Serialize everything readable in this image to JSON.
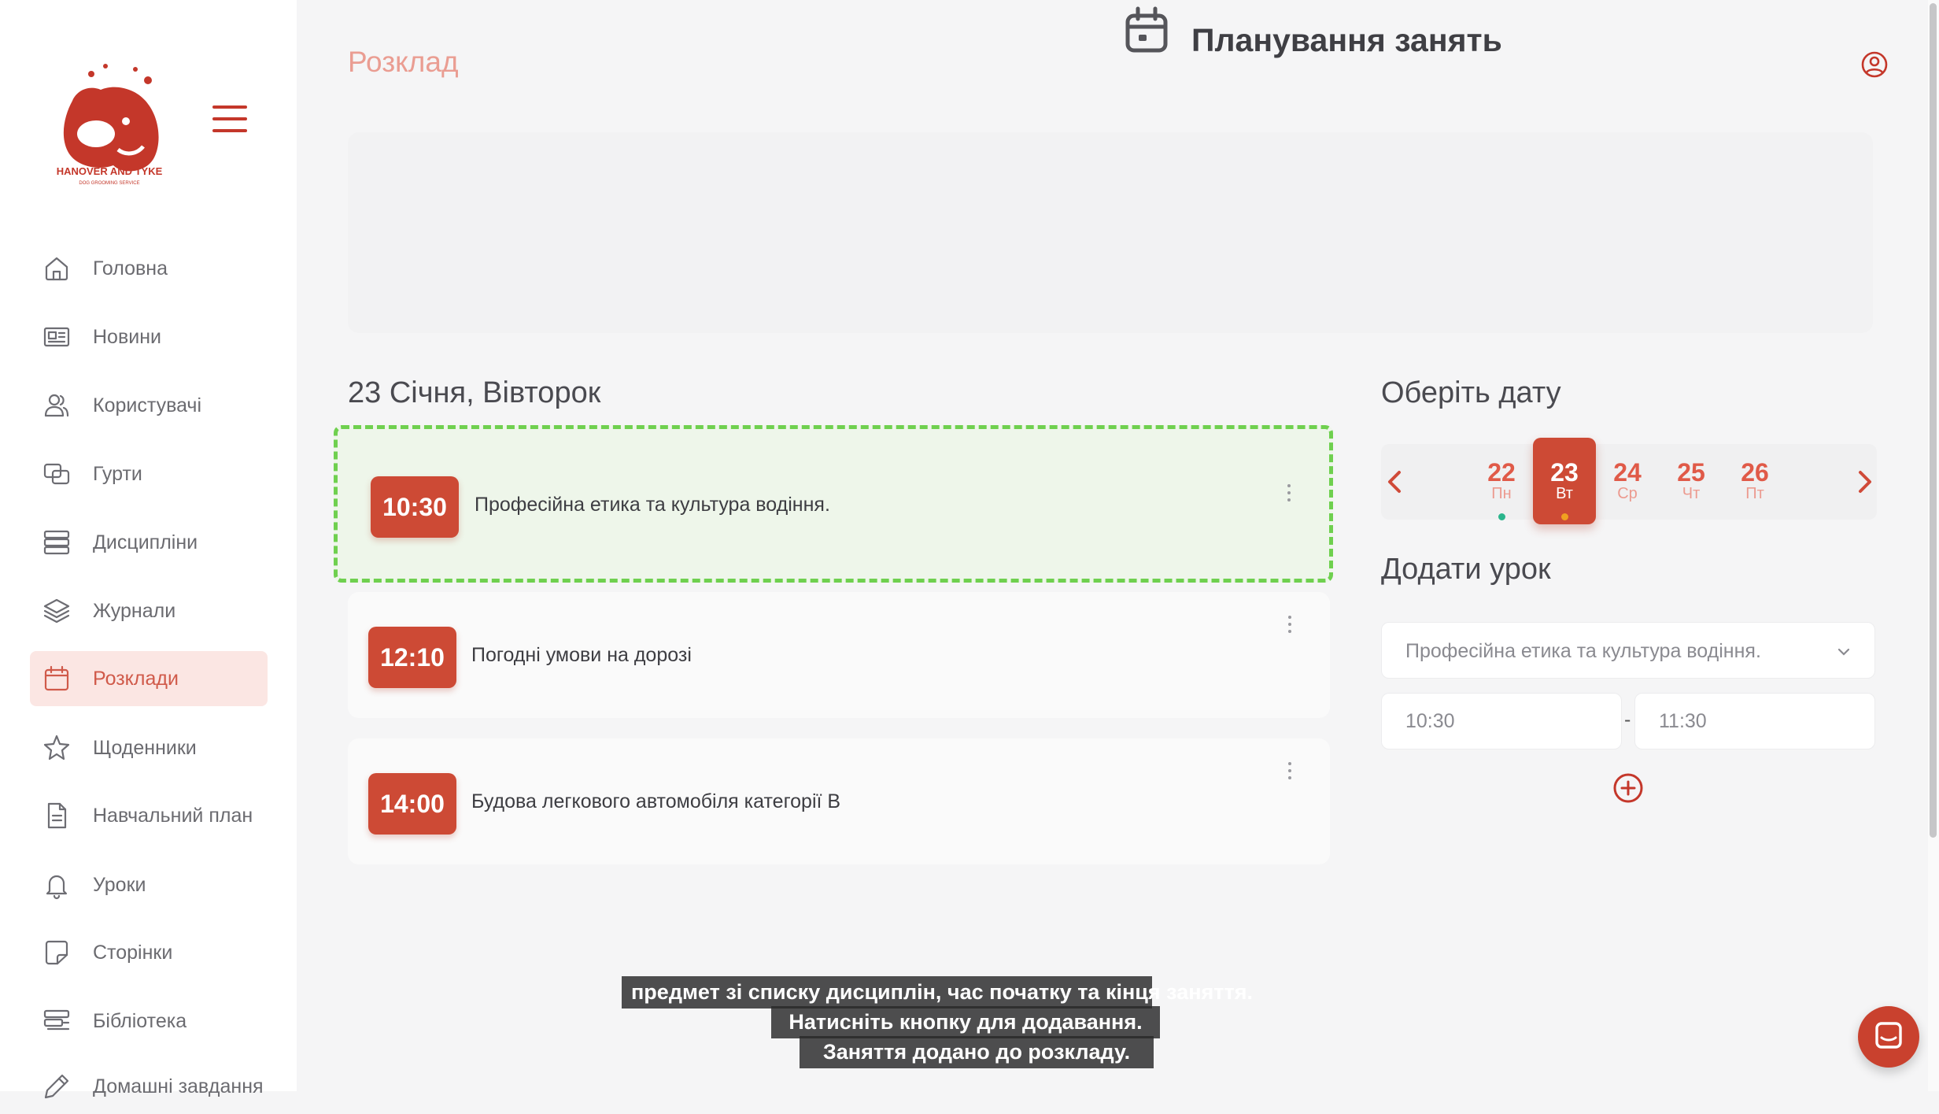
{
  "sidebar": {
    "logo_text": "HANOVER AND TYKE",
    "logo_subtext": "DOG GROOMING SERVICE",
    "items": [
      {
        "label": "Головна",
        "icon": "home-icon"
      },
      {
        "label": "Новини",
        "icon": "newspaper-icon"
      },
      {
        "label": "Користувачі",
        "icon": "users-icon"
      },
      {
        "label": "Гурти",
        "icon": "groups-icon"
      },
      {
        "label": "Дисципліни",
        "icon": "disciplines-icon"
      },
      {
        "label": "Журнали",
        "icon": "layers-icon"
      },
      {
        "label": "Розклади",
        "icon": "calendar-icon",
        "active": true
      },
      {
        "label": "Щоденники",
        "icon": "star-icon"
      },
      {
        "label": "Навчальний план",
        "icon": "document-icon"
      },
      {
        "label": "Уроки",
        "icon": "bell-icon"
      },
      {
        "label": "Сторінки",
        "icon": "page-icon"
      },
      {
        "label": "Бібліотека",
        "icon": "library-icon"
      },
      {
        "label": "Домашні завдання",
        "icon": "edit-icon"
      }
    ]
  },
  "header": {
    "breadcrumb": "Розклад",
    "title": "Планування занять"
  },
  "schedule": {
    "day_title": "23 Січня, Вівторок",
    "lessons": [
      {
        "time": "10:30",
        "title": "Професійна етика та культура водіння."
      },
      {
        "time": "12:10",
        "title": "Погодні умови на дорозі"
      },
      {
        "time": "14:00",
        "title": "Будова легкового автомобіля категорії В"
      }
    ]
  },
  "date_picker": {
    "title": "Оберіть дату",
    "days": [
      {
        "num": "22",
        "wd": "Пн"
      },
      {
        "num": "23",
        "wd": "Вт"
      },
      {
        "num": "24",
        "wd": "Ср"
      },
      {
        "num": "25",
        "wd": "Чт"
      },
      {
        "num": "26",
        "wd": "Пт"
      }
    ],
    "selected_index": 1
  },
  "add_lesson": {
    "title": "Додати урок",
    "subject": "Професійна етика та культура водіння.",
    "start_time": "10:30",
    "end_time": "11:30",
    "separator": "-"
  },
  "subtitles": [
    "предмет зі списку дисциплін, час початку та кінця заняття.",
    "Натисніть кнопку для додавання.",
    "Заняття додано до розкладу."
  ],
  "colors": {
    "accent": "#cd4a35",
    "highlight_border": "#6fd04f",
    "dot_green": "#2bb58c",
    "dot_orange": "#f0a020"
  }
}
